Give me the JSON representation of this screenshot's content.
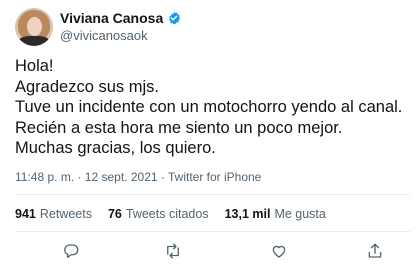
{
  "author": {
    "display_name": "Viviana Canosa",
    "handle": "@vivicanosaok",
    "verified_icon": "verified-badge-icon"
  },
  "tweet": {
    "lines": [
      "Hola!",
      "Agradezco sus mjs.",
      "Tuve un incidente con un motochorro yendo al canal.",
      "Recién a esta hora me siento un poco mejor.",
      "Muchas gracias, los quiero."
    ]
  },
  "meta": {
    "time_source": "11:48 p. m. · 12 sept. 2021 · Twitter for iPhone"
  },
  "stats": {
    "retweets_count": "941",
    "retweets_label": "Retweets",
    "quotes_count": "76",
    "quotes_label": "Tweets citados",
    "likes_count": "13,1 mil",
    "likes_label": "Me gusta"
  },
  "actions": {
    "icons": [
      "reply-icon",
      "retweet-icon",
      "like-icon",
      "share-icon"
    ]
  },
  "colors": {
    "text": "#0f1419",
    "secondary": "#536471",
    "verified": "#1d9bf0",
    "divider": "#e6ecf0"
  }
}
